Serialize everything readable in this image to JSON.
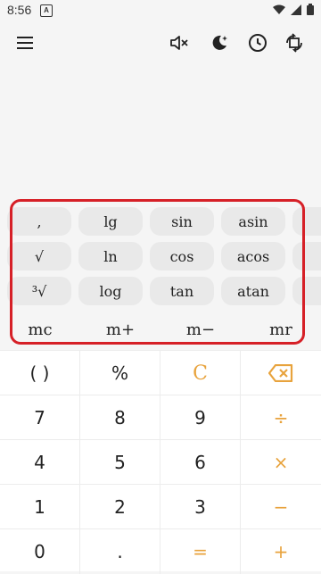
{
  "status": {
    "time": "8:56",
    "badge": "A"
  },
  "toolbar": {
    "menu_icon": "menu-icon",
    "sound_icon": "sound-off-icon",
    "theme_icon": "dark-mode-icon",
    "history_icon": "history-clock-icon",
    "rotate_icon": "screen-rotate-icon"
  },
  "sci_rows": [
    [
      ",",
      "lg",
      "sin",
      "asin"
    ],
    [
      "√",
      "ln",
      "cos",
      "acos"
    ],
    [
      "³√",
      "log",
      "tan",
      "atan"
    ]
  ],
  "memory": [
    "mc",
    "m+",
    "m−",
    "mr"
  ],
  "keypad": [
    [
      "( )",
      "%",
      "C",
      "⌫"
    ],
    [
      "7",
      "8",
      "9",
      "÷"
    ],
    [
      "4",
      "5",
      "6",
      "×"
    ],
    [
      "1",
      "2",
      "3",
      "−"
    ],
    [
      "0",
      ".",
      "=",
      "+"
    ]
  ],
  "colors": {
    "accent": "#e8a33d",
    "highlight": "#d62027"
  }
}
